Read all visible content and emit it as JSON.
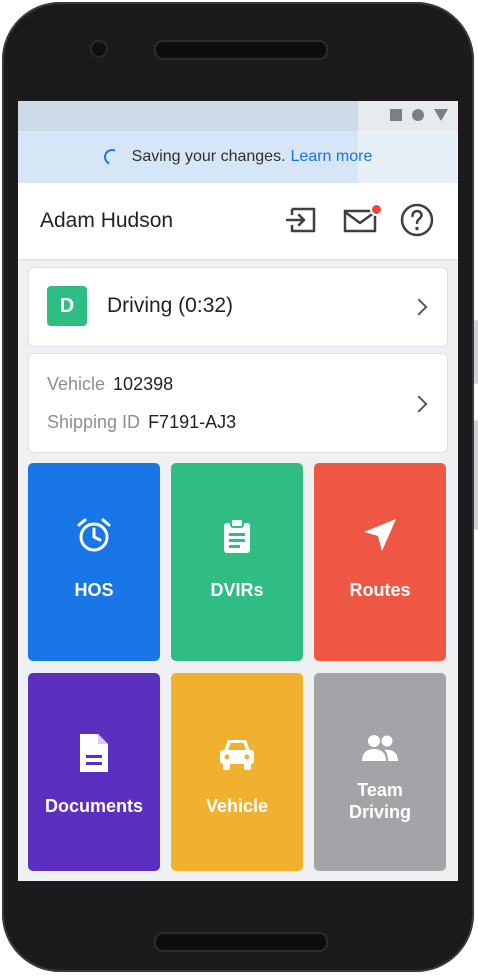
{
  "banner": {
    "message": "Saving your changes.",
    "link": "Learn more"
  },
  "header": {
    "user_name": "Adam Hudson"
  },
  "duty_status": {
    "code": "D",
    "label": "Driving (0:32)"
  },
  "assignment": {
    "vehicle_label": "Vehicle",
    "vehicle_value": "102398",
    "shipping_label": "Shipping ID",
    "shipping_value": "F7191-AJ3"
  },
  "tiles": [
    {
      "label": "HOS",
      "icon": "alarm-clock-icon",
      "color": "#1976e6"
    },
    {
      "label": "DVIRs",
      "icon": "clipboard-icon",
      "color": "#2fbd85"
    },
    {
      "label": "Routes",
      "icon": "navigation-arrow-icon",
      "color": "#ee5744"
    },
    {
      "label": "Documents",
      "icon": "document-icon",
      "color": "#5b2fc0"
    },
    {
      "label": "Vehicle",
      "icon": "car-icon",
      "color": "#f0b12f"
    },
    {
      "label": "Team Driving",
      "icon": "people-icon",
      "color": "#a2a4a7"
    }
  ],
  "colors": {
    "accent": "#1a73e8",
    "notification": "#e8463b"
  }
}
